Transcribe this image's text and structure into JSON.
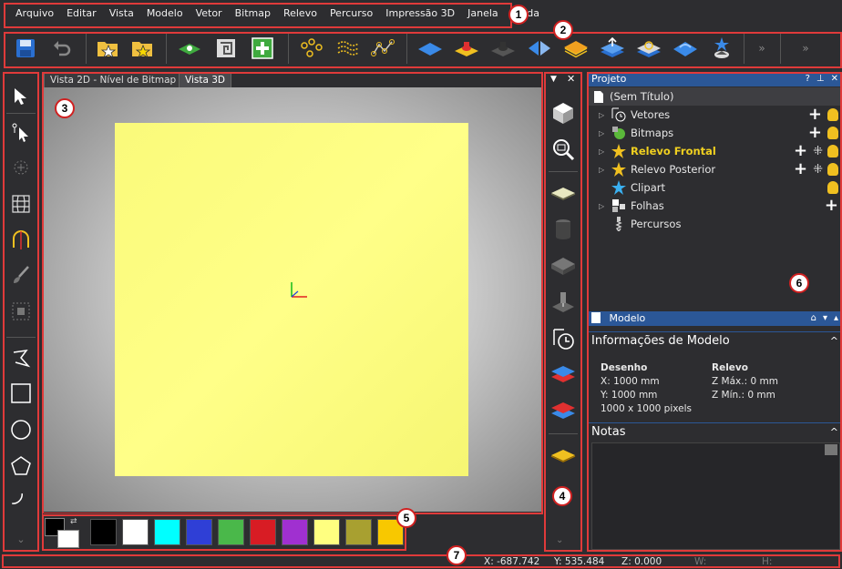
{
  "menu": [
    "Arquivo",
    "Editar",
    "Vista",
    "Modelo",
    "Vetor",
    "Bitmap",
    "Relevo",
    "Percurso",
    "Impressão 3D",
    "Janela",
    "Ajuda"
  ],
  "tabs": [
    "Vista 2D - Nível de Bitmap",
    "Vista 3D"
  ],
  "callouts": [
    "1",
    "2",
    "3",
    "4",
    "5",
    "6",
    "7"
  ],
  "project": {
    "title": "Projeto",
    "root": "(Sem Título)",
    "items": [
      "Vetores",
      "Bitmaps",
      "Relevo Frontal",
      "Relevo Posterior",
      "Clipart",
      "Folhas",
      "Percursos"
    ]
  },
  "model": {
    "title": "Modelo",
    "info_header": "Informações de Modelo",
    "drawing_header": "Desenho",
    "drawing_x": "X: 1000 mm",
    "drawing_y": "Y: 1000 mm",
    "drawing_pixels": "1000 x 1000 pixels",
    "relief_header": "Relevo",
    "relief_zmax": "Z Máx.: 0 mm",
    "relief_zmin": "Z Mín.: 0 mm",
    "notes_header": "Notas"
  },
  "status": {
    "x": "X: -687.742",
    "y": "Y: 535.484",
    "z": "Z: 0.000",
    "w": "W:",
    "h": "H:"
  },
  "palette_colors": [
    "#000000",
    "#ffffff",
    "#00ffff",
    "#2f3fd6",
    "#4ab84a",
    "#d81c24",
    "#a030d0",
    "#ffff80",
    "#a8a030",
    "#f8c800"
  ],
  "accent": "#2b5797",
  "callout_color": "#e03a3a"
}
